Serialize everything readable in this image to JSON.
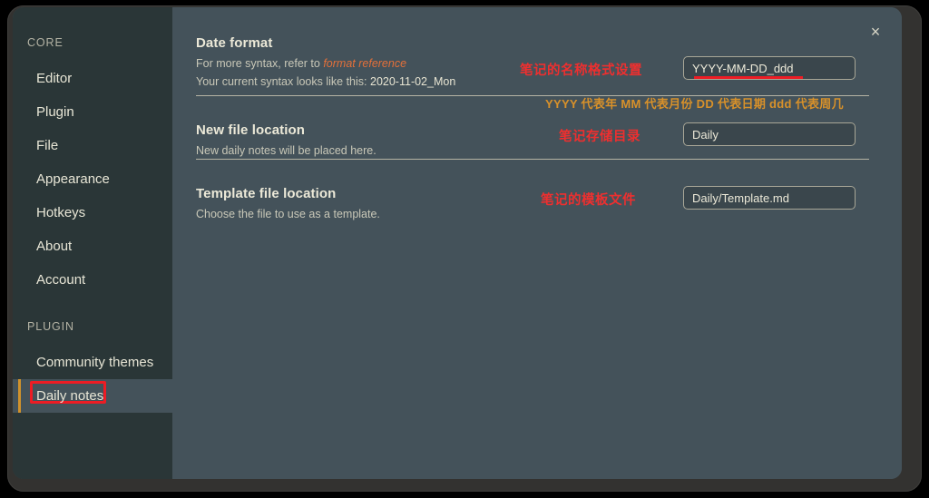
{
  "window": {
    "close_label": "×"
  },
  "sidebar": {
    "sections": [
      {
        "title": "CORE",
        "items": [
          {
            "label": "Editor"
          },
          {
            "label": "Plugin"
          },
          {
            "label": "File"
          },
          {
            "label": "Appearance"
          },
          {
            "label": "Hotkeys"
          },
          {
            "label": "About"
          },
          {
            "label": "Account"
          }
        ]
      },
      {
        "title": "PLUGIN",
        "items": [
          {
            "label": "Community themes"
          },
          {
            "label": "Daily notes"
          }
        ]
      }
    ],
    "selected": "Daily notes"
  },
  "settings": [
    {
      "name": "Date format",
      "desc_prefix": "For more syntax, refer to ",
      "desc_link": "format reference",
      "desc_line2_prefix": "Your current syntax looks like this: ",
      "desc_line2_value": "2020-11-02_Mon",
      "field_value": "YYYY-MM-DD_ddd",
      "annotation_red": "笔记的名称格式设置",
      "annotation_orange": "YYYY 代表年 MM 代表月份 DD 代表日期 ddd 代表周几"
    },
    {
      "name": "New file location",
      "desc": "New daily notes will be placed here.",
      "field_value": "Daily",
      "annotation_red": "笔记存储目录"
    },
    {
      "name": "Template file location",
      "desc": "Choose the file to use as a template.",
      "field_value": "Daily/Template.md",
      "annotation_red": "笔记的模板文件"
    }
  ],
  "colors": {
    "sidebar_bg": "#2a3637",
    "content_bg": "#44525a",
    "accent_orange": "#d1922c",
    "annotation_red": "#ee2f2f",
    "annotation_orange": "#d8912a",
    "link_orange": "#e3703a",
    "text_cream": "#ece9d8"
  }
}
